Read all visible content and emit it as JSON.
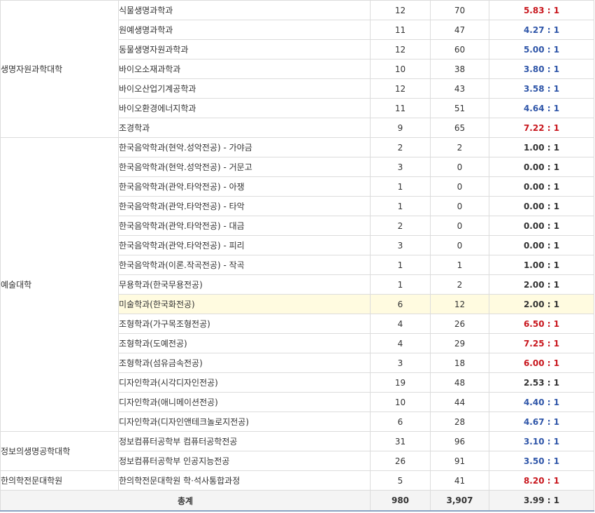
{
  "table": {
    "groups": [
      {
        "college": "생명자원과학대학",
        "rows": [
          {
            "dept": "식물생명과학과",
            "quota": "12",
            "applicants": "70",
            "ratio": "5.83 : 1",
            "color": "red"
          },
          {
            "dept": "원예생명과학과",
            "quota": "11",
            "applicants": "47",
            "ratio": "4.27 : 1",
            "color": "blue"
          },
          {
            "dept": "동물생명자원과학과",
            "quota": "12",
            "applicants": "60",
            "ratio": "5.00 : 1",
            "color": "blue"
          },
          {
            "dept": "바이오소재과학과",
            "quota": "10",
            "applicants": "38",
            "ratio": "3.80 : 1",
            "color": "blue"
          },
          {
            "dept": "바이오산업기계공학과",
            "quota": "12",
            "applicants": "43",
            "ratio": "3.58 : 1",
            "color": "blue"
          },
          {
            "dept": "바이오환경에너지학과",
            "quota": "11",
            "applicants": "51",
            "ratio": "4.64 : 1",
            "color": "blue"
          },
          {
            "dept": "조경학과",
            "quota": "9",
            "applicants": "65",
            "ratio": "7.22 : 1",
            "color": "red"
          }
        ]
      },
      {
        "college": "예술대학",
        "rows": [
          {
            "dept": "한국음악학과(현악.성악전공) - 가야금",
            "quota": "2",
            "applicants": "2",
            "ratio": "1.00 : 1",
            "color": "black"
          },
          {
            "dept": "한국음악학과(현악.성악전공) - 거문고",
            "quota": "3",
            "applicants": "0",
            "ratio": "0.00 : 1",
            "color": "black"
          },
          {
            "dept": "한국음악학과(관악.타악전공) - 아쟁",
            "quota": "1",
            "applicants": "0",
            "ratio": "0.00 : 1",
            "color": "black"
          },
          {
            "dept": "한국음악학과(관악.타악전공) - 타악",
            "quota": "1",
            "applicants": "0",
            "ratio": "0.00 : 1",
            "color": "black"
          },
          {
            "dept": "한국음악학과(관악.타악전공) - 대금",
            "quota": "2",
            "applicants": "0",
            "ratio": "0.00 : 1",
            "color": "black"
          },
          {
            "dept": "한국음악학과(관악.타악전공) - 피리",
            "quota": "3",
            "applicants": "0",
            "ratio": "0.00 : 1",
            "color": "black"
          },
          {
            "dept": "한국음악학과(이론.작곡전공) - 작곡",
            "quota": "1",
            "applicants": "1",
            "ratio": "1.00 : 1",
            "color": "black"
          },
          {
            "dept": "무용학과(한국무용전공)",
            "quota": "1",
            "applicants": "2",
            "ratio": "2.00 : 1",
            "color": "black"
          },
          {
            "dept": "미술학과(한국화전공)",
            "quota": "6",
            "applicants": "12",
            "ratio": "2.00 : 1",
            "color": "black",
            "highlight": true
          },
          {
            "dept": "조형학과(가구목조형전공)",
            "quota": "4",
            "applicants": "26",
            "ratio": "6.50 : 1",
            "color": "red"
          },
          {
            "dept": "조형학과(도예전공)",
            "quota": "4",
            "applicants": "29",
            "ratio": "7.25 : 1",
            "color": "red"
          },
          {
            "dept": "조형학과(섬유금속전공)",
            "quota": "3",
            "applicants": "18",
            "ratio": "6.00 : 1",
            "color": "red"
          },
          {
            "dept": "디자인학과(시각디자인전공)",
            "quota": "19",
            "applicants": "48",
            "ratio": "2.53 : 1",
            "color": "black"
          },
          {
            "dept": "디자인학과(애니메이션전공)",
            "quota": "10",
            "applicants": "44",
            "ratio": "4.40 : 1",
            "color": "blue"
          },
          {
            "dept": "디자인학과(디자인앤테크놀로지전공)",
            "quota": "6",
            "applicants": "28",
            "ratio": "4.67 : 1",
            "color": "blue"
          }
        ]
      },
      {
        "college": "정보의생명공학대학",
        "rows": [
          {
            "dept": "정보컴퓨터공학부 컴퓨터공학전공",
            "quota": "31",
            "applicants": "96",
            "ratio": "3.10 : 1",
            "color": "blue"
          },
          {
            "dept": "정보컴퓨터공학부 인공지능전공",
            "quota": "26",
            "applicants": "91",
            "ratio": "3.50 : 1",
            "color": "blue"
          }
        ]
      },
      {
        "college": "한의학전문대학원",
        "rows": [
          {
            "dept": "한의학전문대학원 학·석사통합과정",
            "quota": "5",
            "applicants": "41",
            "ratio": "8.20 : 1",
            "color": "red"
          }
        ]
      }
    ],
    "total": {
      "label": "총계",
      "quota": "980",
      "applicants": "3,907",
      "ratio": "3.99 : 1"
    }
  }
}
